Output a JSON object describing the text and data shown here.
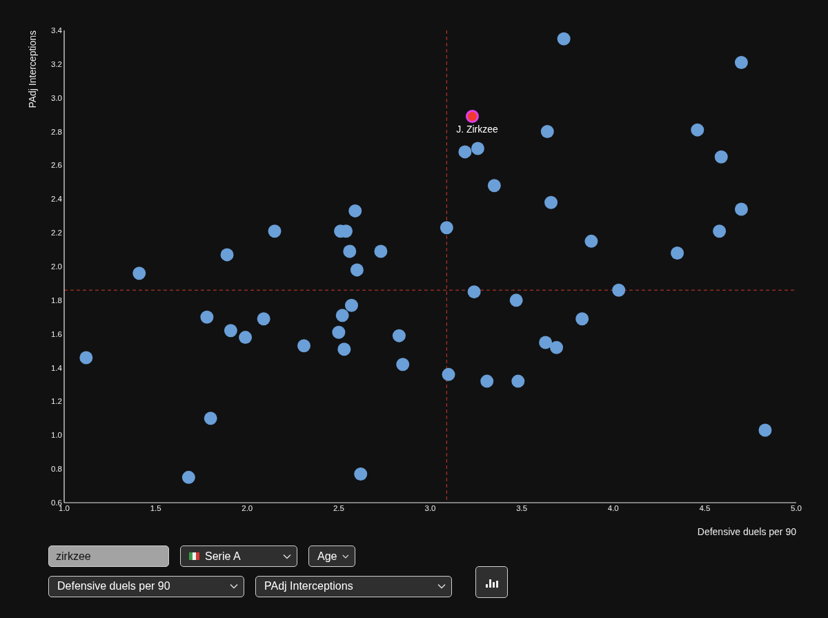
{
  "chart": {
    "chart_data": {
      "type": "scatter",
      "xlabel": "Defensive duels per 90",
      "ylabel": "PAdj Interceptions",
      "xlim": [
        1,
        5
      ],
      "ylim": [
        0.6,
        3.4
      ],
      "xticks": [
        {
          "value": 1,
          "label": "1.0"
        },
        {
          "value": 1.5,
          "label": "1.5"
        },
        {
          "value": 2,
          "label": "2.0"
        },
        {
          "value": 2.5,
          "label": "2.5"
        },
        {
          "value": 3,
          "label": "3.0"
        },
        {
          "value": 3.5,
          "label": "3.5"
        },
        {
          "value": 4,
          "label": "4.0"
        },
        {
          "value": 4.5,
          "label": "4.5"
        },
        {
          "value": 5,
          "label": "5.0"
        }
      ],
      "yticks": [
        {
          "value": 0.6,
          "label": "0.6"
        },
        {
          "value": 0.8,
          "label": "0.8"
        },
        {
          "value": 1,
          "label": "1.0"
        },
        {
          "value": 1.2,
          "label": "1.2"
        },
        {
          "value": 1.4,
          "label": "1.4"
        },
        {
          "value": 1.6,
          "label": "1.6"
        },
        {
          "value": 1.8,
          "label": "1.8"
        },
        {
          "value": 2,
          "label": "2.0"
        },
        {
          "value": 2.2,
          "label": "2.2"
        },
        {
          "value": 2.4,
          "label": "2.4"
        },
        {
          "value": 2.6,
          "label": "2.6"
        },
        {
          "value": 2.8,
          "label": "2.8"
        },
        {
          "value": 3,
          "label": "3.0"
        },
        {
          "value": 3.2,
          "label": "3.2"
        },
        {
          "value": 3.4,
          "label": "3.4"
        }
      ],
      "series": [
        {
          "color": "#6a9fd8",
          "x": [
            3.73,
            4.7,
            3.64,
            4.46,
            4.59,
            3.19,
            3.26,
            3.35,
            3.66,
            4.7,
            2.59,
            2.15,
            2.51,
            2.54,
            3.09,
            4.58,
            3.88,
            1.89,
            2.56,
            2.73,
            4.35,
            2.6,
            1.41,
            4.03,
            3.24,
            3.47,
            2.57,
            1.78,
            2.52,
            2.09,
            3.83,
            1.91,
            2.5,
            1.99,
            2.83,
            2.31,
            2.53,
            3.63,
            3.69,
            1.12,
            2.85,
            3.1,
            3.31,
            3.48,
            1.8,
            4.83,
            1.68,
            2.62
          ],
          "values": [
            3.35,
            3.21,
            2.8,
            2.81,
            2.65,
            2.68,
            2.7,
            2.48,
            2.38,
            2.34,
            2.33,
            2.21,
            2.21,
            2.21,
            2.23,
            2.21,
            2.15,
            2.07,
            2.09,
            2.09,
            2.08,
            1.98,
            1.96,
            1.86,
            1.85,
            1.8,
            1.77,
            1.7,
            1.71,
            1.69,
            1.69,
            1.62,
            1.61,
            1.58,
            1.59,
            1.53,
            1.51,
            1.55,
            1.52,
            1.46,
            1.42,
            1.36,
            1.32,
            1.32,
            1.1,
            1.03,
            0.75,
            0.77
          ]
        },
        {
          "name": "J. Zirkzee",
          "color": "#f03a2e",
          "x": [
            3.23
          ],
          "values": [
            2.89
          ]
        }
      ],
      "ref_lines": [
        {
          "axis": "x",
          "value": 3.09,
          "color": "#d23a2e"
        },
        {
          "axis": "y",
          "value": 1.86,
          "color": "#d23a2e"
        }
      ]
    }
  },
  "controls": {
    "search": {
      "value": "zirkzee"
    },
    "league": {
      "label": "Serie A"
    },
    "sort": {
      "label": "Age"
    },
    "x_metric": {
      "label": "Defensive duels per 90"
    },
    "y_metric": {
      "label": "PAdj Interceptions"
    }
  }
}
